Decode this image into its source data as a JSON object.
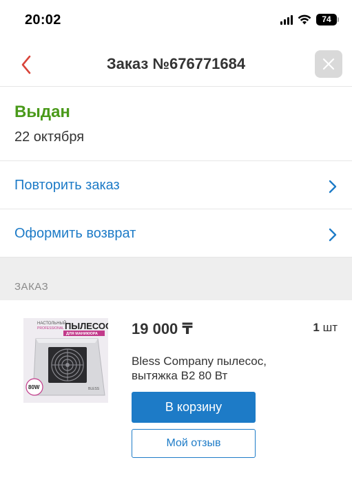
{
  "status_bar": {
    "time": "20:02",
    "battery": "74",
    "icons": [
      "signal-icon",
      "wifi-icon",
      "battery-icon"
    ]
  },
  "header": {
    "title": "Заказ №676771684",
    "back_icon": "chevron-left-icon",
    "close_icon": "close-icon"
  },
  "order": {
    "status": "Выдан",
    "date": "22 октября"
  },
  "actions": [
    {
      "label": "Повторить заказ",
      "icon": "chevron-right-icon"
    },
    {
      "label": "Оформить возврат",
      "icon": "chevron-right-icon"
    }
  ],
  "section": {
    "label": "ЗАКАЗ"
  },
  "product": {
    "price": "19 000 ₸",
    "quantity": "1",
    "quantity_unit": "шт",
    "name": "Bless Company пылесос, вытяжка В2 80 Вт",
    "cart_button": "В корзину",
    "review_button": "Мой отзыв",
    "image_text": {
      "line1": "НАСТОЛЬНЫЙ",
      "line2": "PROFESSIONAL",
      "headline": "ПЫЛЕСОС",
      "tag": "ДЛЯ МАНИКЮРА",
      "badge": "80W",
      "brand": "BLESS"
    }
  },
  "colors": {
    "accent": "#1d7bc7",
    "status_green": "#4a9a1a",
    "back_red": "#d9443a",
    "section_bg": "#eeeeee"
  }
}
